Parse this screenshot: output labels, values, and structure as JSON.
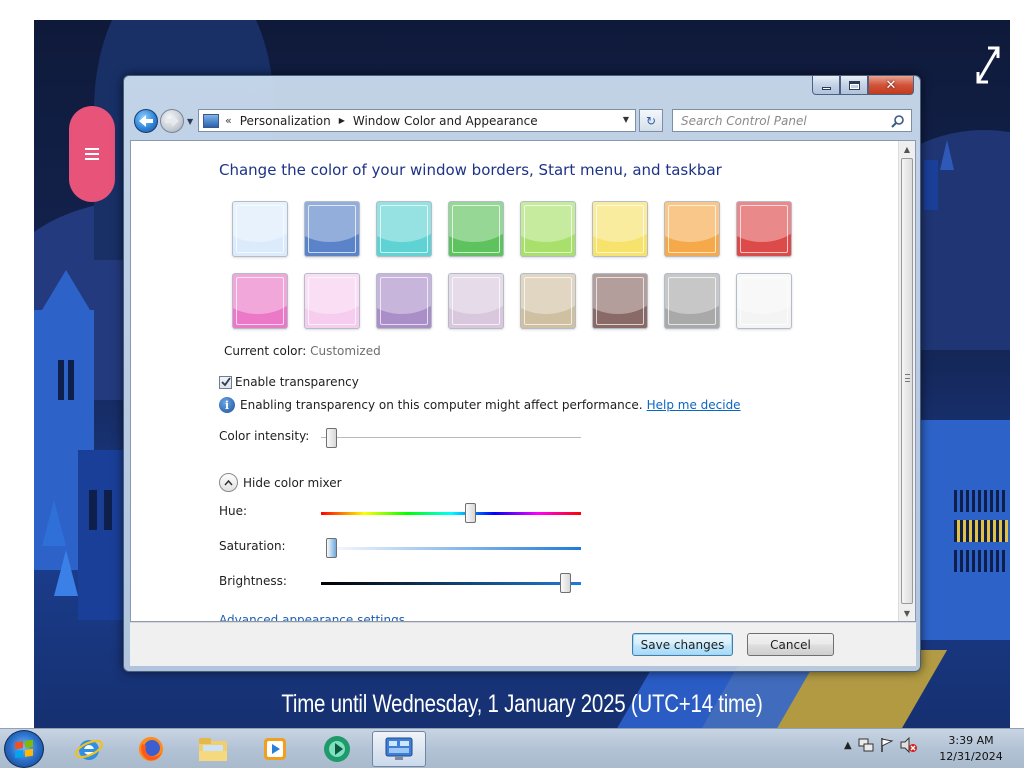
{
  "window": {
    "breadcrumb": [
      "Personalization",
      "Window Color and Appearance"
    ],
    "search_placeholder": "Search Control Panel",
    "title": "Change the color of your window borders, Start menu, and taskbar",
    "current_color_label": "Current color:",
    "current_color_value": "Customized",
    "transparency_label": "Enable transparency",
    "transparency_checked": true,
    "info_text": "Enabling transparency on this computer might affect performance.",
    "help_link": "Help me decide",
    "intensity_label": "Color intensity:",
    "intensity_fraction": 0.02,
    "mixer_toggle_label": "Hide color mixer",
    "hue_label": "Hue:",
    "hue_fraction": 0.58,
    "saturation_label": "Saturation:",
    "saturation_fraction": 0.02,
    "brightness_label": "Brightness:",
    "brightness_fraction": 0.96,
    "advanced_link": "Advanced appearance settings...",
    "save_label": "Save changes",
    "cancel_label": "Cancel",
    "swatches": [
      {
        "name": "sky",
        "color": "#dcebfb"
      },
      {
        "name": "twilight",
        "color": "#5b83c9"
      },
      {
        "name": "sea",
        "color": "#5fd3d3"
      },
      {
        "name": "leaf",
        "color": "#5ec25e"
      },
      {
        "name": "lime",
        "color": "#a8e06b"
      },
      {
        "name": "lemon",
        "color": "#f7e26b"
      },
      {
        "name": "pumpkin",
        "color": "#f5a94a"
      },
      {
        "name": "ruby",
        "color": "#dd4a4a"
      },
      {
        "name": "fuchsia",
        "color": "#ec78c8"
      },
      {
        "name": "blush",
        "color": "#f6cdee"
      },
      {
        "name": "violet",
        "color": "#a98ec8"
      },
      {
        "name": "lavender",
        "color": "#d9c8dd"
      },
      {
        "name": "taupe",
        "color": "#cfc0a2"
      },
      {
        "name": "chocolate",
        "color": "#8a6a66"
      },
      {
        "name": "slate",
        "color": "#a9a9a9"
      },
      {
        "name": "frost",
        "color": "#f4f4f4"
      }
    ]
  },
  "desktop": {
    "countdown": "Time until Wednesday, 1 January 2025 (UTC+14 time)"
  },
  "taskbar": {
    "apps": [
      "internet-explorer",
      "firefox",
      "file-explorer",
      "media-player",
      "app-green",
      "control-panel"
    ],
    "clock_time": "3:39 AM",
    "clock_date": "12/31/2024"
  }
}
